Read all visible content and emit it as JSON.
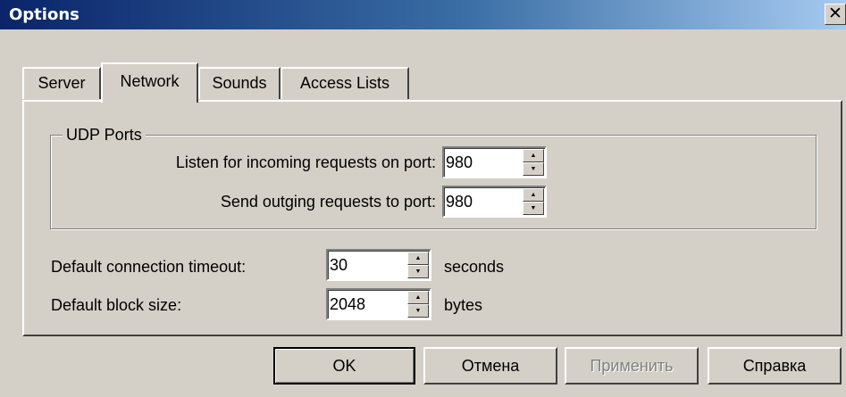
{
  "window": {
    "title": "Options",
    "close_glyph": "✕"
  },
  "tabs": [
    {
      "label": "Server",
      "active": false
    },
    {
      "label": "Network",
      "active": true
    },
    {
      "label": "Sounds",
      "active": false
    },
    {
      "label": "Access Lists",
      "active": false
    }
  ],
  "udp": {
    "group_title": "UDP Ports",
    "listen_label": "Listen for incoming requests on port:",
    "listen_value": "980",
    "send_label": "Send outging requests to port:",
    "send_value": "980"
  },
  "timeout": {
    "label": "Default connection timeout:",
    "value": "30",
    "unit": "seconds"
  },
  "block": {
    "label": "Default block size:",
    "value": "2048",
    "unit": "bytes"
  },
  "buttons": {
    "ok": "OK",
    "cancel": "Отмена",
    "apply": "Применить",
    "help": "Справка"
  },
  "icons": {
    "spin_up": "▲",
    "spin_down": "▼"
  }
}
